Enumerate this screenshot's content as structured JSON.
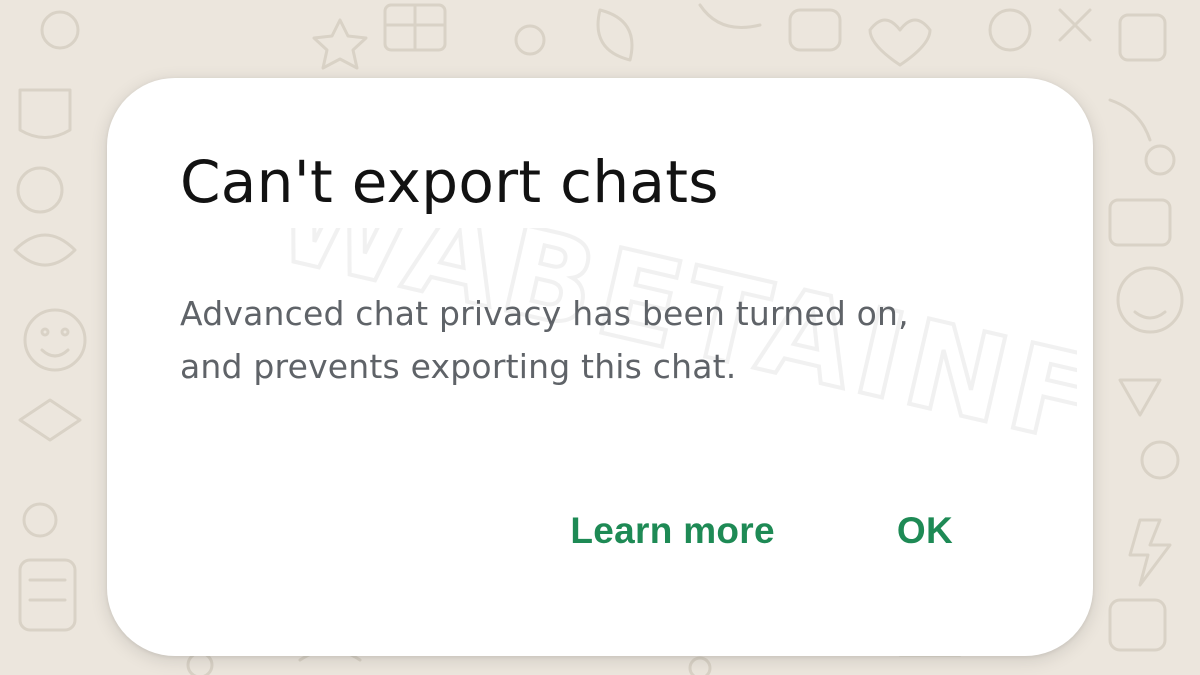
{
  "dialog": {
    "title": "Can't export chats",
    "message": "Advanced chat privacy has been turned on, and prevents exporting this chat.",
    "buttons": {
      "learn_more": "Learn more",
      "ok": "OK"
    },
    "watermark": "WABETAINFO"
  },
  "colors": {
    "accent": "#1e8a55",
    "title_text": "#121212",
    "body_text": "#5f6368",
    "wallpaper": "#ece6dd",
    "dialog_bg": "#ffffff"
  }
}
